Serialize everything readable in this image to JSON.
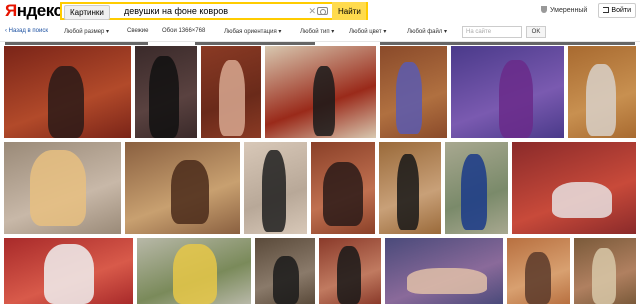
{
  "header": {
    "logo_first": "Я",
    "logo_rest": "ндекс",
    "search_chip": "Картинки",
    "query": "девушки на фоне ковров",
    "clear_symbol": "✕",
    "find_label": "Найти",
    "safe_label": "Умеренный",
    "login_label": "Войти"
  },
  "filters": {
    "back": "‹ Назад в поиск",
    "items": [
      "Любой размер",
      "Свежие",
      "Обои 1366×768",
      "Любая ориентация",
      "Любой тип",
      "Любой цвет",
      "Любой файл"
    ],
    "site_placeholder": "На сайте",
    "ok_label": "OK"
  },
  "colors": {
    "accent": "#ffcc00",
    "logo_red": "#e61400",
    "link": "#1a4fa0"
  },
  "images": [
    {
      "row": 1,
      "bg": "#7a2418",
      "bg2": "#b24a2a",
      "fig": "#2a1a18"
    },
    {
      "row": 1,
      "bg": "#3a2a2a",
      "bg2": "#5a4240",
      "fig": "#101010"
    },
    {
      "row": 1,
      "bg": "#8a3a24",
      "bg2": "#6a2a1a",
      "fig": "#d8a890"
    },
    {
      "row": 1,
      "bg": "#d8c8b0",
      "bg2": "#9a2a1a",
      "fig": "#1a1a1a"
    },
    {
      "row": 1,
      "bg": "#8a4a2a",
      "bg2": "#b07040",
      "fig": "#5a5ab0"
    },
    {
      "row": 1,
      "bg": "#4a3a8a",
      "bg2": "#7a5ab0",
      "fig": "#6a2a8a"
    },
    {
      "row": 1,
      "bg": "#a86a30",
      "bg2": "#c89050",
      "fig": "#d8d0c8"
    },
    {
      "row": 2,
      "bg": "#9a8a78",
      "bg2": "#c8b8a8",
      "fig": "#e8c080"
    },
    {
      "row": 2,
      "bg": "#8a6040",
      "bg2": "#c8a070",
      "fig": "#4a2a1a"
    },
    {
      "row": 2,
      "bg": "#d8c8b8",
      "bg2": "#b8a898",
      "fig": "#202020"
    },
    {
      "row": 2,
      "bg": "#8a4028",
      "bg2": "#c07050",
      "fig": "#2a1a18"
    },
    {
      "row": 2,
      "bg": "#9a6a3a",
      "bg2": "#c8a078",
      "fig": "#181818"
    },
    {
      "row": 2,
      "bg": "#a8a890",
      "bg2": "#7a8a6a",
      "fig": "#1a3a8a"
    },
    {
      "row": 2,
      "bg": "#8a2a2a",
      "bg2": "#c84a3a",
      "fig": "#e8e0e0"
    },
    {
      "row": 3,
      "bg": "#a82a2a",
      "bg2": "#d85a4a",
      "fig": "#f0f0f0"
    },
    {
      "row": 3,
      "bg": "#b8b8a8",
      "bg2": "#7a8a5a",
      "fig": "#e8c848"
    },
    {
      "row": 3,
      "bg": "#5a4a3a",
      "bg2": "#8a7a6a",
      "fig": "#1a1a1a"
    },
    {
      "row": 3,
      "bg": "#8a3a2a",
      "bg2": "#c07a60",
      "fig": "#181818"
    },
    {
      "row": 3,
      "bg": "#4a4a7a",
      "bg2": "#8a6a9a",
      "fig": "#e0c0a8"
    },
    {
      "row": 3,
      "bg": "#b87040",
      "bg2": "#d8a070",
      "fig": "#5a3a2a"
    },
    {
      "row": 3,
      "bg": "#7a5a3a",
      "bg2": "#b08060",
      "fig": "#d8c8a8"
    }
  ]
}
